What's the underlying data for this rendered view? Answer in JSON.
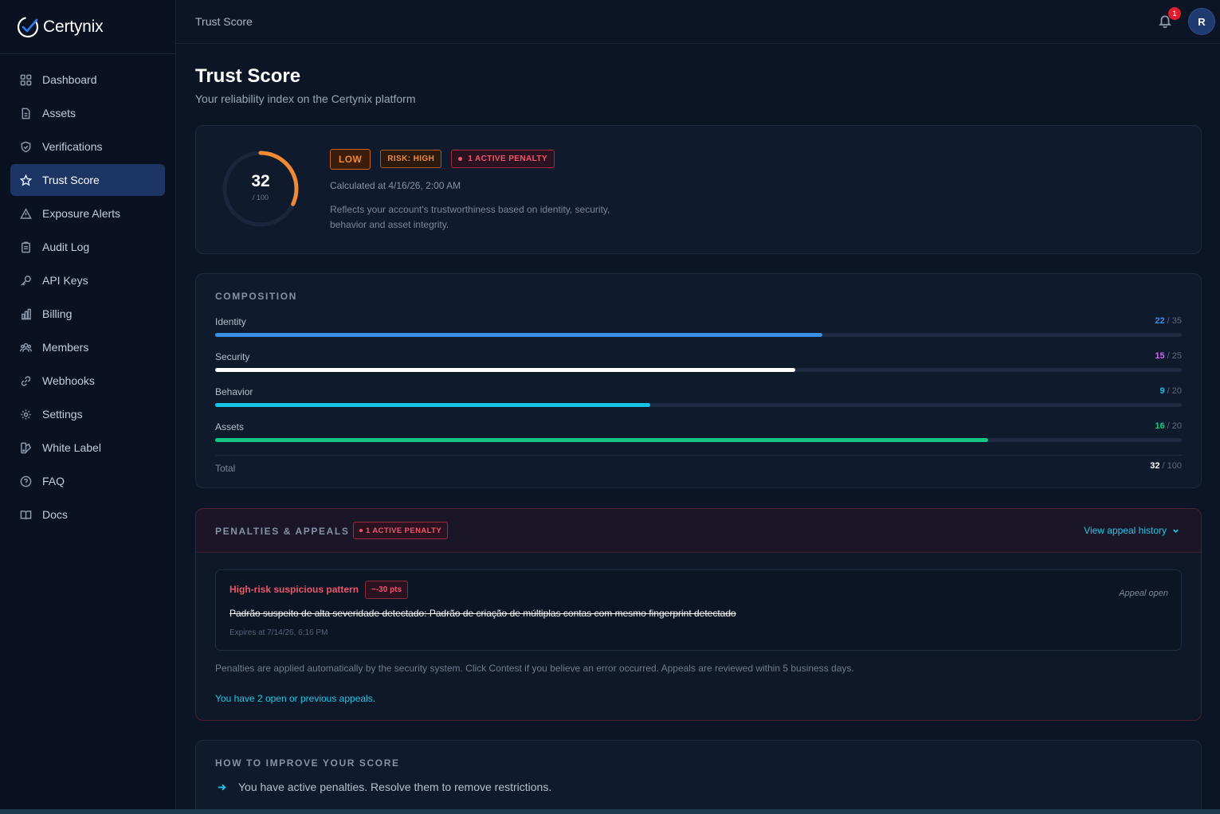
{
  "brand": {
    "name": "Certynix"
  },
  "sidebar": {
    "items": [
      {
        "label": "Dashboard",
        "icon": "grid-icon"
      },
      {
        "label": "Assets",
        "icon": "file-icon"
      },
      {
        "label": "Verifications",
        "icon": "shield-icon"
      },
      {
        "label": "Trust Score",
        "icon": "star-icon",
        "active": true
      },
      {
        "label": "Exposure Alerts",
        "icon": "warning-icon"
      },
      {
        "label": "Audit Log",
        "icon": "clipboard-icon"
      },
      {
        "label": "API Keys",
        "icon": "key-icon"
      },
      {
        "label": "Billing",
        "icon": "bar-chart-icon"
      },
      {
        "label": "Members",
        "icon": "users-icon"
      },
      {
        "label": "Webhooks",
        "icon": "link-icon"
      },
      {
        "label": "Settings",
        "icon": "gear-icon"
      },
      {
        "label": "White Label",
        "icon": "palette-icon"
      },
      {
        "label": "FAQ",
        "icon": "help-icon"
      },
      {
        "label": "Docs",
        "icon": "book-icon"
      }
    ]
  },
  "topbar": {
    "title": "Trust Score",
    "notification_count": "1",
    "avatar_initial": "R"
  },
  "page": {
    "title": "Trust Score",
    "subtitle": "Your reliability index on the Certynix platform"
  },
  "score": {
    "value": "32",
    "max": "/ 100",
    "fraction": 0.32,
    "level_badge": "LOW",
    "risk_badge": "RISK: HIGH",
    "penalty_badge": "1 ACTIVE PENALTY",
    "calculated": "Calculated at 4/16/26, 2:00 AM",
    "description": "Reflects your account's trustworthiness based on identity, security, behavior and asset integrity."
  },
  "composition": {
    "title": "COMPOSITION",
    "rows": [
      {
        "label": "Identity",
        "value": "22",
        "max": "/ 35",
        "color": "#3b8fe6"
      },
      {
        "label": "Security",
        "value": "15",
        "max": "/ 25",
        "color": "#c46cf0",
        "bar_color": "#ffffff"
      },
      {
        "label": "Behavior",
        "value": "9",
        "max": "/ 20",
        "color": "#16c1e8"
      },
      {
        "label": "Assets",
        "value": "16",
        "max": "/ 20",
        "color": "#16c784"
      }
    ],
    "total_label": "Total",
    "total_value": "32",
    "total_max": "/ 100"
  },
  "penalties": {
    "title": "PENALTIES & APPEALS",
    "badge": "1 ACTIVE PENALTY",
    "view_history": "View appeal history",
    "item": {
      "title": "High-risk suspicious pattern",
      "points": "−-30 pts",
      "description": "Padrão suspeito de alta severidade detectado: Padrão de criação de múltiplas contas com mesmo fingerprint detectado",
      "expires": "Expires at 7/14/26, 6:16 PM",
      "status": "Appeal open"
    },
    "note": "Penalties are applied automatically by the security system. Click Contest if you believe an error occurred. Appeals are reviewed within 5 business days.",
    "open_appeals": "You have 2 open or previous appeals."
  },
  "improve": {
    "title": "HOW TO IMPROVE YOUR SCORE",
    "items": [
      "You have active penalties. Resolve them to remove restrictions."
    ]
  }
}
